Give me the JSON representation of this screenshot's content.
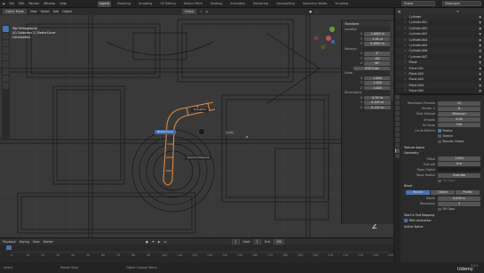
{
  "menu": {
    "items": [
      "File",
      "Edit",
      "Render",
      "Window",
      "Help"
    ],
    "workspaces": [
      "Layout",
      "Modeling",
      "Sculpting",
      "UV Editing",
      "Texture Paint",
      "Shading",
      "Animation",
      "Rendering",
      "Compositing",
      "Geometry Nodes",
      "Scripting"
    ],
    "active_workspace": "Layout",
    "scene": "Scene",
    "view_layer": "ViewLayer"
  },
  "header": {
    "mode": "Object Mode",
    "view": "View",
    "select": "Select",
    "add": "Add",
    "object": "Object",
    "transform": "Global",
    "options": "Options"
  },
  "viewport": {
    "info": [
      "Top Orthographic",
      "(0) Collection 2 | BezierCurve",
      "Centimeters"
    ],
    "labels": {
      "label_a": "ScaleEnd",
      "label_b": "BezierCurve",
      "label_c": "Cube",
      "label_d": "Second Pressure"
    }
  },
  "npanel": {
    "transform_title": "Transform",
    "location_title": "Location",
    "location": [
      {
        "axis": "X",
        "value": "1.4649 m"
      },
      {
        "axis": "Y",
        "value": "1.54 m"
      },
      {
        "axis": "Z",
        "value": "0.3893 m"
      }
    ],
    "rotation_title": "Rotation",
    "rotation": [
      {
        "axis": "X",
        "value": "0°"
      },
      {
        "axis": "Y",
        "value": "-90°"
      },
      {
        "axis": "Z",
        "value": "90°"
      }
    ],
    "mode": "XYZ Euler",
    "scale_title": "Scale",
    "scale": [
      {
        "axis": "X",
        "value": "1.000"
      },
      {
        "axis": "Y",
        "value": "1.000"
      },
      {
        "axis": "Z",
        "value": "1.000"
      }
    ],
    "dimensions_title": "Dimensions",
    "dimensions": [
      {
        "axis": "X",
        "value": "0.15 m"
      },
      {
        "axis": "Y",
        "value": "0.205 m"
      },
      {
        "axis": "Z",
        "value": "0.125 m"
      }
    ]
  },
  "outliner": {
    "rows": [
      "Cylinder",
      "Cylinder.001",
      "Cylinder.002",
      "Cylinder.003",
      "Cylinder.004",
      "Cylinder.005",
      "Cylinder.006",
      "Cylinder.007",
      "Plane",
      "Plane.001",
      "Plane.002",
      "Plane.003",
      "Plane.004",
      "Plane.005"
    ]
  },
  "properties": {
    "resolution_preview_label": "Resolution Preview",
    "resolution_preview": "12",
    "render_label": "Render U",
    "render": "0",
    "twist_method_label": "Twist Method",
    "twist_method": "Minimum",
    "smooth_label": "Smooth",
    "smooth": "0.00",
    "fill_mode_label": "Fill Mode",
    "fill_mode": "Full",
    "curve_deform_label": "Curve Deform",
    "radius_label": "Radius",
    "stretch_label": "Stretch",
    "bounds_clamp_label": "Bounds Clamp",
    "texture_space": "Texture Space",
    "geometry": "Geometry",
    "offset_label": "Offset",
    "offset": "1.000",
    "extrude_label": "Extrude",
    "extrude": "0 m",
    "taper_label": "Taper Object",
    "taper_mode_label": "Taper Radius",
    "taper_mode": "Override",
    "fill_caps_label": "Fill Caps",
    "bevel": "Bevel",
    "bevel_modes": [
      "Round",
      "Object",
      "Profile"
    ],
    "depth_label": "Depth",
    "depth": "0.038 m",
    "resolution_label": "Resolution",
    "resolution": "4",
    "fill_caps2_label": "Fill Caps",
    "start_end_mapping": "Start & End Mapping",
    "path_animation": "Path Animation",
    "active_spline": "Active Spline"
  },
  "timeline": {
    "playback": "Playback",
    "keying": "Keying",
    "view": "View",
    "marker": "Marker",
    "frame": "1",
    "start_label": "Start",
    "start": "1",
    "end_label": "End",
    "end": "250",
    "ticks": [
      "0",
      "10",
      "20",
      "30",
      "40",
      "50",
      "60",
      "70",
      "80",
      "90",
      "100",
      "110",
      "120",
      "130",
      "140",
      "150",
      "160",
      "170",
      "180",
      "190",
      "200",
      "210",
      "220",
      "230",
      "240",
      "250"
    ]
  },
  "statusbar": {
    "select": "Select",
    "rotate": "Rotate View",
    "menu": "Object Context Menu",
    "version": "3.2.2"
  },
  "watermark": "Udemy"
}
